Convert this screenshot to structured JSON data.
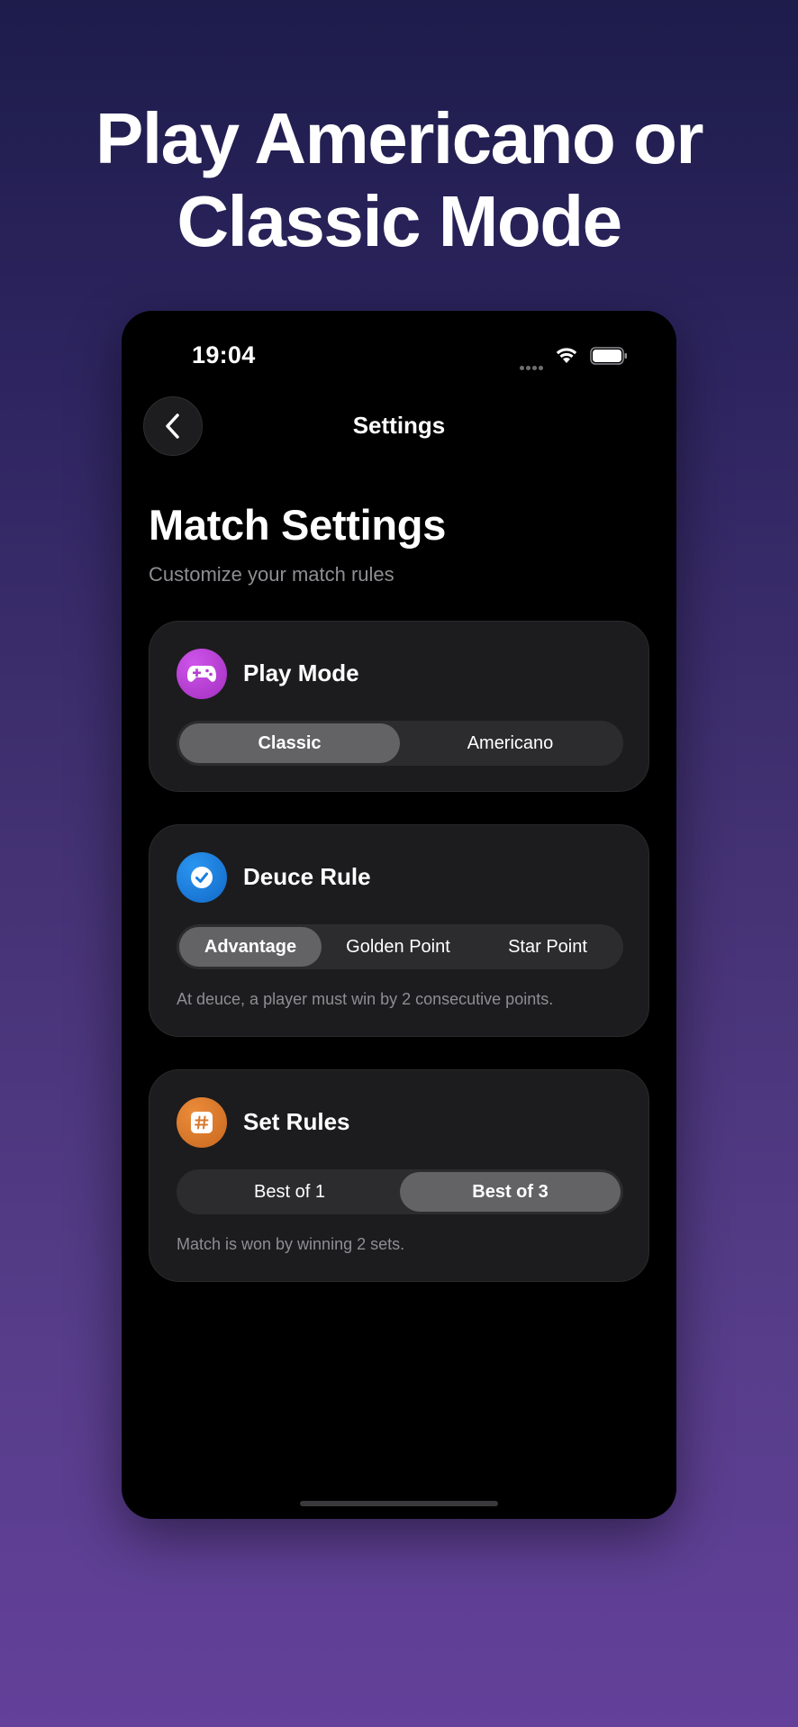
{
  "headline": {
    "line1": "Play Americano or",
    "line2": "Classic Mode"
  },
  "status_bar": {
    "time": "19:04"
  },
  "nav": {
    "title": "Settings"
  },
  "page": {
    "title": "Match Settings",
    "subtitle": "Customize your match rules"
  },
  "play_mode": {
    "title": "Play Mode",
    "icon": "gamepad-icon",
    "icon_color": "#b33fd0",
    "options": [
      "Classic",
      "Americano"
    ],
    "selected": "Classic"
  },
  "deuce_rule": {
    "title": "Deuce Rule",
    "icon": "checkmark-icon",
    "icon_color": "#1a7fe0",
    "options": [
      "Advantage",
      "Golden Point",
      "Star Point"
    ],
    "selected": "Advantage",
    "note": "At deuce, a player must win by 2 consecutive points."
  },
  "set_rules": {
    "title": "Set Rules",
    "icon": "hash-icon",
    "icon_color": "#d8782a",
    "options": [
      "Best of 1",
      "Best of 3"
    ],
    "selected": "Best of 3",
    "note": "Match is won by winning 2 sets."
  },
  "colors": {
    "background_top": "#1d1c4b",
    "background_bottom": "#63409a",
    "card": "#1c1c1e",
    "segment_active": "#636366"
  }
}
